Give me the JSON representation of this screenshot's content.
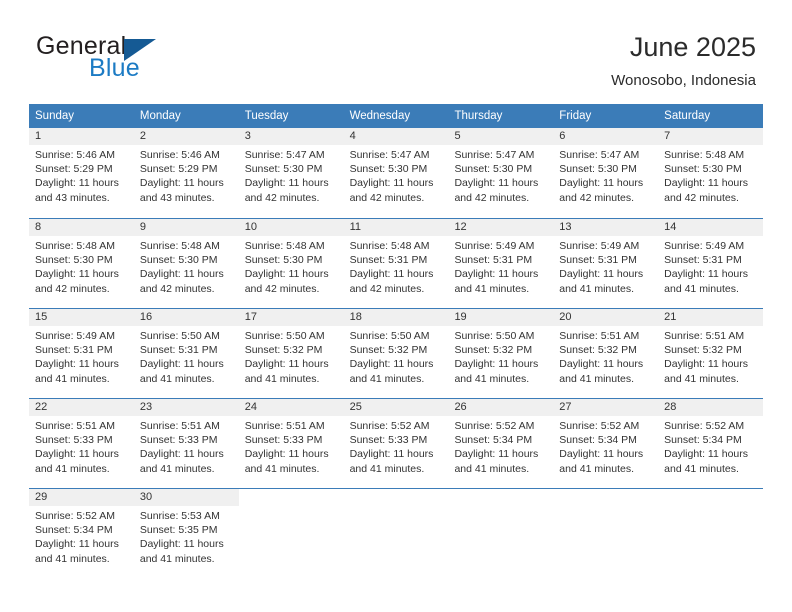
{
  "brand": {
    "word1": "General",
    "word2": "Blue",
    "triangle_color": "#155a94",
    "blue_color": "#1c7bc4"
  },
  "header": {
    "title": "June 2025",
    "subtitle": "Wonosobo, Indonesia"
  },
  "theme": {
    "header_blue": "#3b7cb8",
    "day_band_gray": "#f0f0f0",
    "text": "#333333"
  },
  "weekdays": [
    "Sunday",
    "Monday",
    "Tuesday",
    "Wednesday",
    "Thursday",
    "Friday",
    "Saturday"
  ],
  "weeks": [
    [
      {
        "num": "1",
        "lines": [
          "Sunrise: 5:46 AM",
          "Sunset: 5:29 PM",
          "Daylight: 11 hours",
          "and 43 minutes."
        ]
      },
      {
        "num": "2",
        "lines": [
          "Sunrise: 5:46 AM",
          "Sunset: 5:29 PM",
          "Daylight: 11 hours",
          "and 43 minutes."
        ]
      },
      {
        "num": "3",
        "lines": [
          "Sunrise: 5:47 AM",
          "Sunset: 5:30 PM",
          "Daylight: 11 hours",
          "and 42 minutes."
        ]
      },
      {
        "num": "4",
        "lines": [
          "Sunrise: 5:47 AM",
          "Sunset: 5:30 PM",
          "Daylight: 11 hours",
          "and 42 minutes."
        ]
      },
      {
        "num": "5",
        "lines": [
          "Sunrise: 5:47 AM",
          "Sunset: 5:30 PM",
          "Daylight: 11 hours",
          "and 42 minutes."
        ]
      },
      {
        "num": "6",
        "lines": [
          "Sunrise: 5:47 AM",
          "Sunset: 5:30 PM",
          "Daylight: 11 hours",
          "and 42 minutes."
        ]
      },
      {
        "num": "7",
        "lines": [
          "Sunrise: 5:48 AM",
          "Sunset: 5:30 PM",
          "Daylight: 11 hours",
          "and 42 minutes."
        ]
      }
    ],
    [
      {
        "num": "8",
        "lines": [
          "Sunrise: 5:48 AM",
          "Sunset: 5:30 PM",
          "Daylight: 11 hours",
          "and 42 minutes."
        ]
      },
      {
        "num": "9",
        "lines": [
          "Sunrise: 5:48 AM",
          "Sunset: 5:30 PM",
          "Daylight: 11 hours",
          "and 42 minutes."
        ]
      },
      {
        "num": "10",
        "lines": [
          "Sunrise: 5:48 AM",
          "Sunset: 5:30 PM",
          "Daylight: 11 hours",
          "and 42 minutes."
        ]
      },
      {
        "num": "11",
        "lines": [
          "Sunrise: 5:48 AM",
          "Sunset: 5:31 PM",
          "Daylight: 11 hours",
          "and 42 minutes."
        ]
      },
      {
        "num": "12",
        "lines": [
          "Sunrise: 5:49 AM",
          "Sunset: 5:31 PM",
          "Daylight: 11 hours",
          "and 41 minutes."
        ]
      },
      {
        "num": "13",
        "lines": [
          "Sunrise: 5:49 AM",
          "Sunset: 5:31 PM",
          "Daylight: 11 hours",
          "and 41 minutes."
        ]
      },
      {
        "num": "14",
        "lines": [
          "Sunrise: 5:49 AM",
          "Sunset: 5:31 PM",
          "Daylight: 11 hours",
          "and 41 minutes."
        ]
      }
    ],
    [
      {
        "num": "15",
        "lines": [
          "Sunrise: 5:49 AM",
          "Sunset: 5:31 PM",
          "Daylight: 11 hours",
          "and 41 minutes."
        ]
      },
      {
        "num": "16",
        "lines": [
          "Sunrise: 5:50 AM",
          "Sunset: 5:31 PM",
          "Daylight: 11 hours",
          "and 41 minutes."
        ]
      },
      {
        "num": "17",
        "lines": [
          "Sunrise: 5:50 AM",
          "Sunset: 5:32 PM",
          "Daylight: 11 hours",
          "and 41 minutes."
        ]
      },
      {
        "num": "18",
        "lines": [
          "Sunrise: 5:50 AM",
          "Sunset: 5:32 PM",
          "Daylight: 11 hours",
          "and 41 minutes."
        ]
      },
      {
        "num": "19",
        "lines": [
          "Sunrise: 5:50 AM",
          "Sunset: 5:32 PM",
          "Daylight: 11 hours",
          "and 41 minutes."
        ]
      },
      {
        "num": "20",
        "lines": [
          "Sunrise: 5:51 AM",
          "Sunset: 5:32 PM",
          "Daylight: 11 hours",
          "and 41 minutes."
        ]
      },
      {
        "num": "21",
        "lines": [
          "Sunrise: 5:51 AM",
          "Sunset: 5:32 PM",
          "Daylight: 11 hours",
          "and 41 minutes."
        ]
      }
    ],
    [
      {
        "num": "22",
        "lines": [
          "Sunrise: 5:51 AM",
          "Sunset: 5:33 PM",
          "Daylight: 11 hours",
          "and 41 minutes."
        ]
      },
      {
        "num": "23",
        "lines": [
          "Sunrise: 5:51 AM",
          "Sunset: 5:33 PM",
          "Daylight: 11 hours",
          "and 41 minutes."
        ]
      },
      {
        "num": "24",
        "lines": [
          "Sunrise: 5:51 AM",
          "Sunset: 5:33 PM",
          "Daylight: 11 hours",
          "and 41 minutes."
        ]
      },
      {
        "num": "25",
        "lines": [
          "Sunrise: 5:52 AM",
          "Sunset: 5:33 PM",
          "Daylight: 11 hours",
          "and 41 minutes."
        ]
      },
      {
        "num": "26",
        "lines": [
          "Sunrise: 5:52 AM",
          "Sunset: 5:34 PM",
          "Daylight: 11 hours",
          "and 41 minutes."
        ]
      },
      {
        "num": "27",
        "lines": [
          "Sunrise: 5:52 AM",
          "Sunset: 5:34 PM",
          "Daylight: 11 hours",
          "and 41 minutes."
        ]
      },
      {
        "num": "28",
        "lines": [
          "Sunrise: 5:52 AM",
          "Sunset: 5:34 PM",
          "Daylight: 11 hours",
          "and 41 minutes."
        ]
      }
    ],
    [
      {
        "num": "29",
        "lines": [
          "Sunrise: 5:52 AM",
          "Sunset: 5:34 PM",
          "Daylight: 11 hours",
          "and 41 minutes."
        ]
      },
      {
        "num": "30",
        "lines": [
          "Sunrise: 5:53 AM",
          "Sunset: 5:35 PM",
          "Daylight: 11 hours",
          "and 41 minutes."
        ]
      },
      {
        "num": "",
        "lines": []
      },
      {
        "num": "",
        "lines": []
      },
      {
        "num": "",
        "lines": []
      },
      {
        "num": "",
        "lines": []
      },
      {
        "num": "",
        "lines": []
      }
    ]
  ]
}
